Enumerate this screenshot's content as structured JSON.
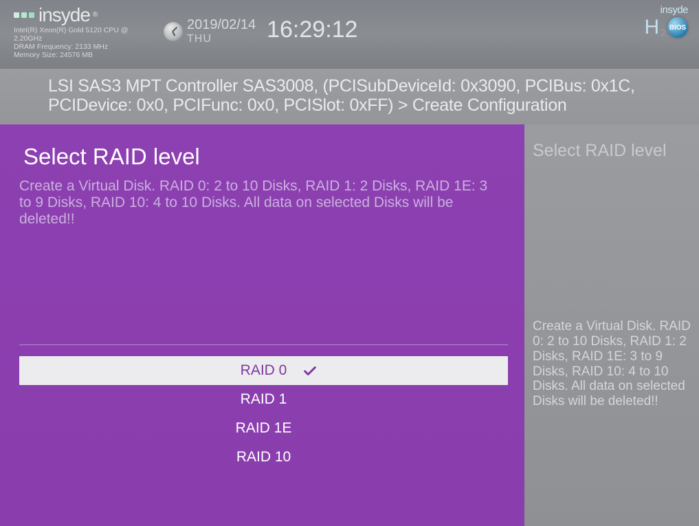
{
  "header": {
    "brand": "insyde",
    "cpu": "Intel(R) Xeon(R) Gold 5120 CPU @ 2.20GHz",
    "dram": "DRAM Frequency: 2133 MHz",
    "memory": "Memory Size: 24576 MB",
    "date": "2019/02/14",
    "day": "THU",
    "time": "16:29:12",
    "bios_brand": "insyde",
    "bios_badge": "BIOS"
  },
  "breadcrumb": "LSI SAS3 MPT Controller SAS3008, (PCISubDeviceId: 0x3090, PCIBus: 0x1C, PCIDevice: 0x0, PCIFunc: 0x0, PCISlot: 0xFF) > Create Configuration",
  "left": {
    "title": "Select RAID level",
    "description": "Create a Virtual Disk. RAID 0: 2 to 10 Disks, RAID 1: 2 Disks, RAID 1E: 3 to 9 Disks, RAID 10: 4 to 10 Disks. All data on selected Disks will be deleted!!",
    "options": [
      {
        "label": "RAID 0",
        "selected": true
      },
      {
        "label": "RAID 1",
        "selected": false
      },
      {
        "label": "RAID 1E",
        "selected": false
      },
      {
        "label": "RAID 10",
        "selected": false
      }
    ]
  },
  "right": {
    "title": "Select RAID level",
    "description": "Create a Virtual Disk. RAID 0: 2 to 10 Disks, RAID 1: 2 Disks, RAID 1E: 3 to 9 Disks, RAID 10: 4 to 10 Disks. All data on selected Disks will be deleted!!"
  }
}
